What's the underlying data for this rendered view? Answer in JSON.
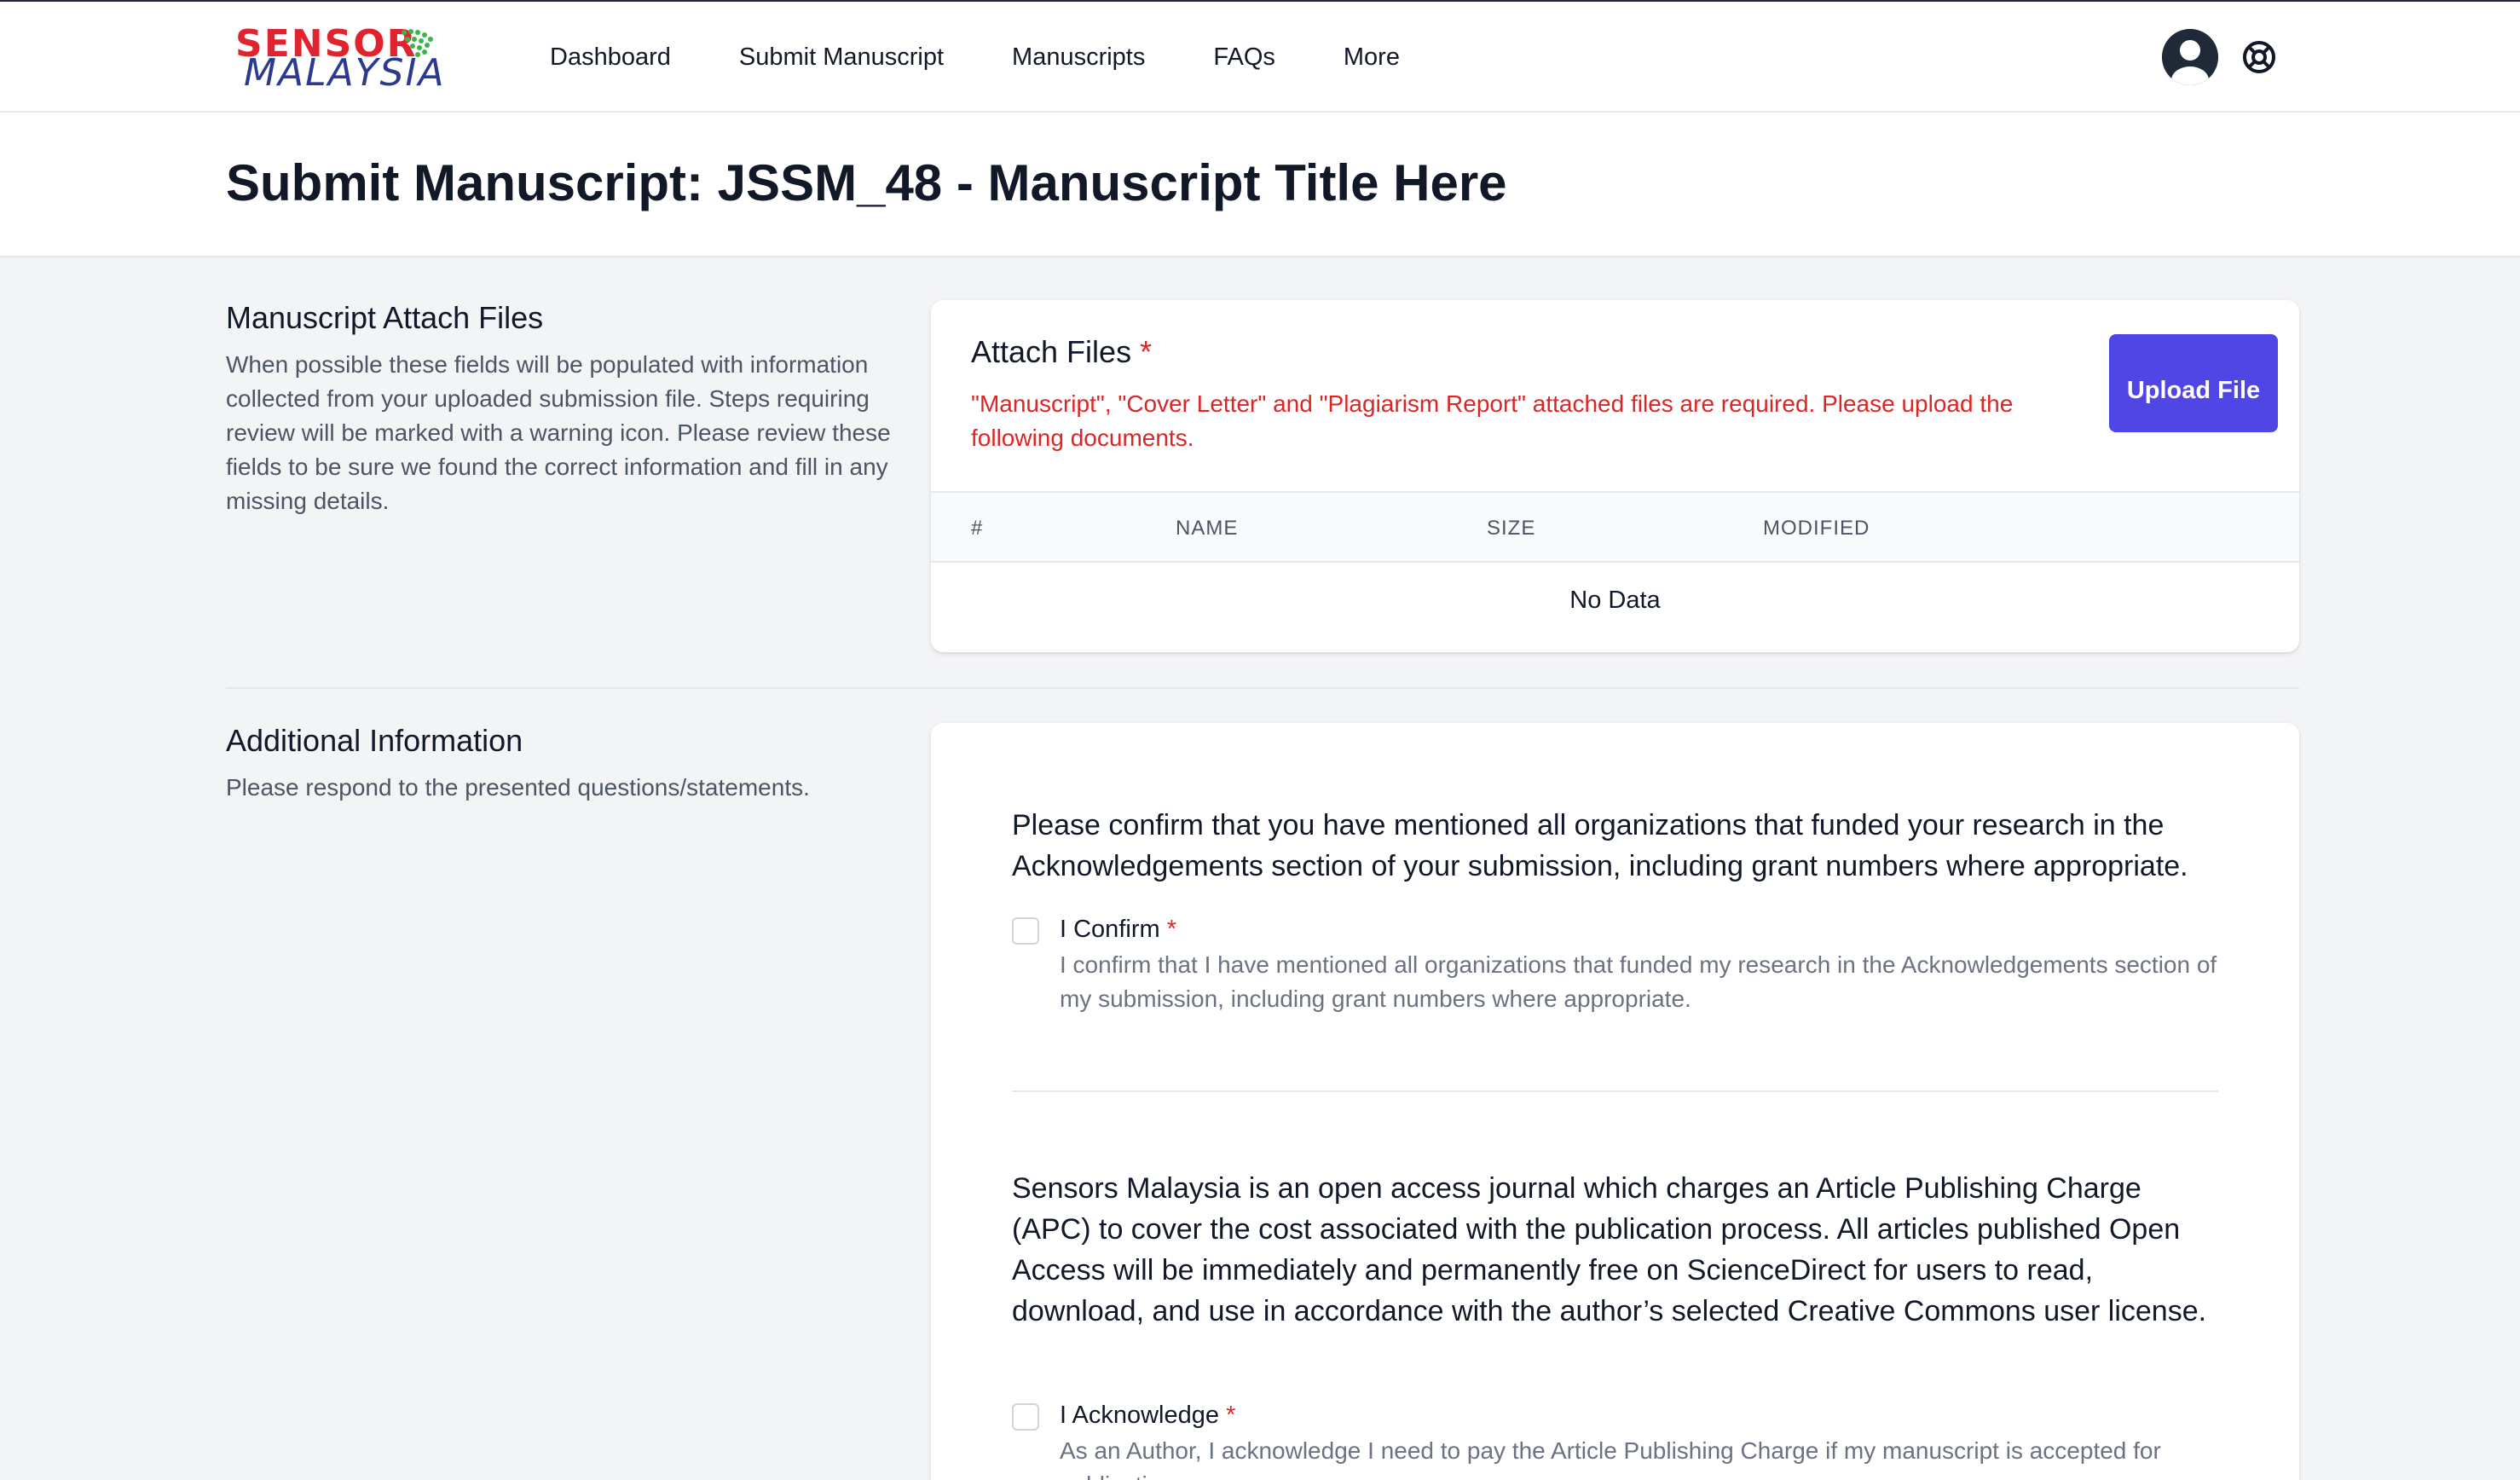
{
  "nav": {
    "logo_top": "SENSOR",
    "logo_bottom": "MALAYSIA",
    "items": [
      "Dashboard",
      "Submit Manuscript",
      "Manuscripts",
      "FAQs",
      "More"
    ]
  },
  "header": {
    "title": "Submit Manuscript: JSSM_48 - Manuscript Title Here"
  },
  "attach_section": {
    "title": "Manuscript Attach Files",
    "description": "When possible these fields will be populated with information collected from your uploaded submission file. Steps requiring review will be marked with a warning icon. Please review these fields to be sure we found the correct information and fill in any missing details.",
    "card_title": "Attach Files",
    "required_mark": "*",
    "error": "\"Manuscript\", \"Cover Letter\" and \"Plagiarism Report\" attached files are required. Please upload the following documents.",
    "upload_label": "Upload File",
    "columns": [
      "#",
      "NAME",
      "SIZE",
      "MODIFIED"
    ],
    "empty_text": "No Data"
  },
  "additional_section": {
    "title": "Additional Information",
    "description": "Please respond to the presented questions/statements.",
    "questions": [
      {
        "text": "Please confirm that you have mentioned all organizations that funded your research in the Acknowledgements section of your submission, including grant numbers where appropriate.",
        "checkbox_label": "I Confirm",
        "required_mark": "*",
        "checkbox_desc": "I confirm that I have mentioned all organizations that funded my research in the Acknowledgements section of my submission, including grant numbers where appropriate."
      },
      {
        "text": "Sensors Malaysia is an open access journal which charges an Article Publishing Charge (APC) to cover the cost associated with the publication process. All articles published Open Access will be immediately and permanently free on ScienceDirect for users to read, download, and use in accordance with the author’s selected Creative Commons user license.",
        "checkbox_label": "I Acknowledge",
        "required_mark": "*",
        "checkbox_desc": "As an Author, I acknowledge I need to pay the Article Publishing Charge if my manuscript is accepted for publication."
      }
    ]
  },
  "colors": {
    "accent": "#4f46e5",
    "error": "#dc2626",
    "logo_red": "#e0232f",
    "logo_blue": "#2b3990"
  },
  "icons": [
    "user-avatar-icon",
    "help-lifebuoy-icon"
  ]
}
